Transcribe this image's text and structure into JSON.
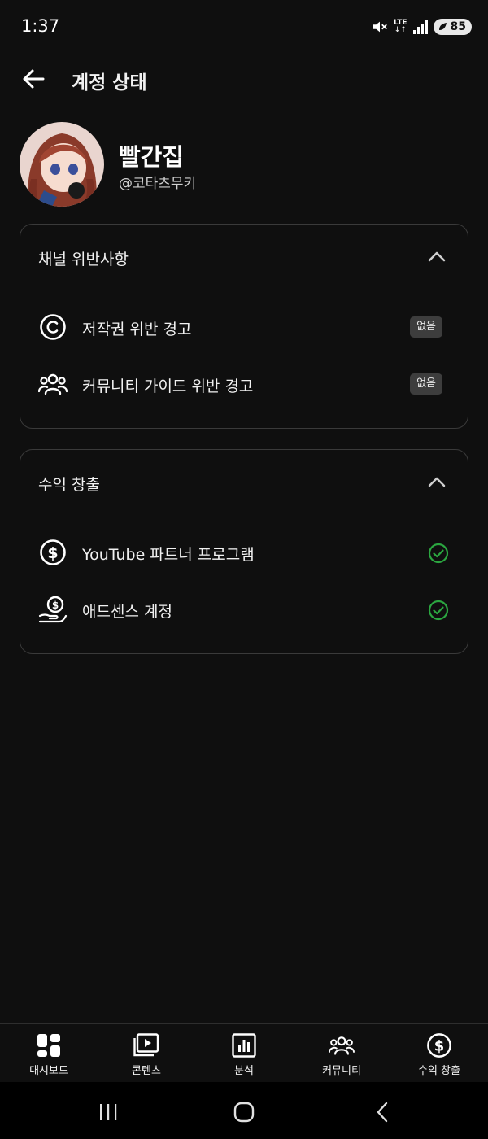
{
  "status_bar": {
    "time": "1:37",
    "network": "LTE",
    "battery": "85"
  },
  "header": {
    "title": "계정 상태"
  },
  "channel": {
    "name": "빨간집",
    "handle": "@코타츠무키"
  },
  "violations": {
    "title": "채널 위반사항",
    "items": [
      {
        "label": "저작권 위반 경고",
        "badge": "없음",
        "icon": "copyright-icon"
      },
      {
        "label": "커뮤니티 가이드 위반 경고",
        "badge": "없음",
        "icon": "community-icon"
      }
    ]
  },
  "monetization": {
    "title": "수익 창출",
    "items": [
      {
        "label": "YouTube 파트너 프로그램",
        "status": "check",
        "icon": "dollar-circle-icon"
      },
      {
        "label": "애드센스 계정",
        "status": "check",
        "icon": "money-hand-icon"
      }
    ]
  },
  "bottom_nav": [
    {
      "label": "대시보드",
      "icon": "dashboard-icon"
    },
    {
      "label": "콘텐츠",
      "icon": "content-icon"
    },
    {
      "label": "분석",
      "icon": "analytics-icon"
    },
    {
      "label": "커뮤니티",
      "icon": "community-icon"
    },
    {
      "label": "수익 창출",
      "icon": "monetization-icon"
    }
  ],
  "colors": {
    "background": "#0f0f0f",
    "success": "#2ba640",
    "border": "#3a3a3a",
    "badge": "#3d3d3d"
  }
}
